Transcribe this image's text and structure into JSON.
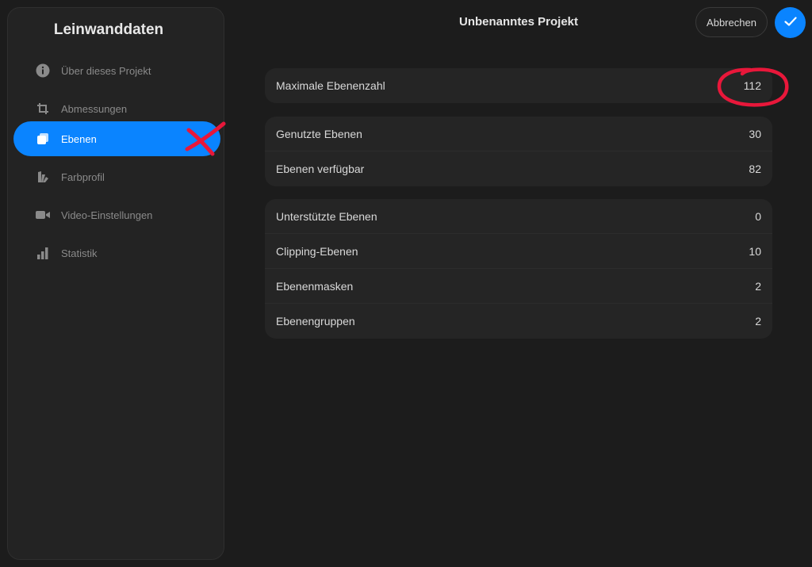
{
  "sidebar": {
    "title": "Leinwanddaten",
    "items": [
      {
        "label": "Über dieses Projekt",
        "icon": "info-icon",
        "active": false
      },
      {
        "label": "Abmessungen",
        "icon": "crop-icon",
        "active": false
      },
      {
        "label": "Ebenen",
        "icon": "layers-icon",
        "active": true
      },
      {
        "label": "Farbprofil",
        "icon": "color-profile-icon",
        "active": false
      },
      {
        "label": "Video-Einstellungen",
        "icon": "video-camera-icon",
        "active": false
      },
      {
        "label": "Statistik",
        "icon": "bar-chart-icon",
        "active": false
      }
    ]
  },
  "header": {
    "title": "Unbenanntes Projekt",
    "cancel_label": "Abbrechen",
    "confirm_icon": "checkmark-icon"
  },
  "groups": [
    {
      "rows": [
        {
          "label": "Maximale Ebenenzahl",
          "value": "112"
        }
      ]
    },
    {
      "rows": [
        {
          "label": "Genutzte Ebenen",
          "value": "30"
        },
        {
          "label": "Ebenen verfügbar",
          "value": "82"
        }
      ]
    },
    {
      "rows": [
        {
          "label": "Unterstützte Ebenen",
          "value": "0"
        },
        {
          "label": "Clipping-Ebenen",
          "value": "10"
        },
        {
          "label": "Ebenenmasken",
          "value": "2"
        },
        {
          "label": "Ebenengruppen",
          "value": "2"
        }
      ]
    }
  ],
  "colors": {
    "accent": "#0a84ff",
    "annotation": "#e8173a",
    "background": "#1c1c1c"
  }
}
